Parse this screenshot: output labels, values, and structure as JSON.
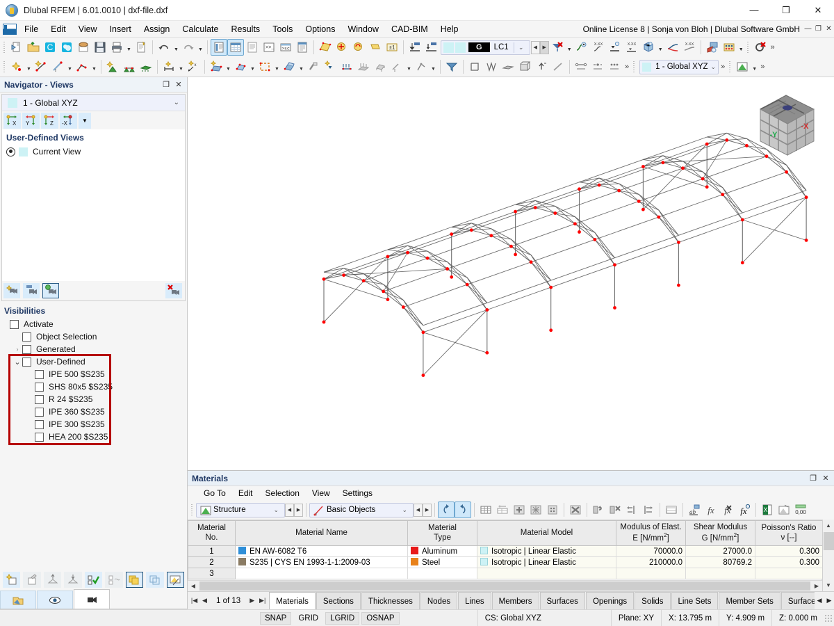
{
  "titlebar": {
    "title": "Dlubal RFEM | 6.01.0010 | dxf-file.dxf",
    "minimize": "—",
    "maximize": "❐",
    "close": "✕"
  },
  "menubar": {
    "items": [
      "File",
      "Edit",
      "View",
      "Insert",
      "Assign",
      "Calculate",
      "Results",
      "Tools",
      "Options",
      "Window",
      "CAD-BIM",
      "Help"
    ],
    "license": "Online License 8 | Sonja von Bloh | Dlubal Software GmbH",
    "mdi_minimize": "—",
    "mdi_restore": "❐",
    "mdi_close": "✕"
  },
  "toolbar": {
    "load_case": {
      "tag": "G",
      "name": "LC1"
    },
    "view_select": "1 - Global XYZ",
    "overflow": "»"
  },
  "navigator": {
    "title": "Navigator - Views",
    "restore_icon": "❐",
    "close_icon": "✕",
    "view_current": "1 - Global XYZ",
    "axis_buttons": [
      "X",
      "Y",
      "Z",
      "-X"
    ],
    "user_defined_views_label": "User-Defined Views",
    "current_view_label": "Current View",
    "visibilities_label": "Visibilities",
    "tree": [
      {
        "label": "Activate",
        "indent": 0,
        "checked": false,
        "expander": ""
      },
      {
        "label": "Object Selection",
        "indent": 1,
        "checked": false,
        "expander": ""
      },
      {
        "label": "Generated",
        "indent": 1,
        "checked": false,
        "expander": "›"
      },
      {
        "label": "User-Defined",
        "indent": 1,
        "checked": false,
        "expander": "⌄"
      },
      {
        "label": "IPE 500 $S235",
        "indent": 2,
        "checked": false,
        "expander": ""
      },
      {
        "label": "SHS 80x5 $S235",
        "indent": 2,
        "checked": false,
        "expander": ""
      },
      {
        "label": "R 24 $S235",
        "indent": 2,
        "checked": false,
        "expander": ""
      },
      {
        "label": "IPE 360 $S235",
        "indent": 2,
        "checked": false,
        "expander": ""
      },
      {
        "label": "IPE 300 $S235",
        "indent": 2,
        "checked": false,
        "expander": ""
      },
      {
        "label": "HEA 200 $S235",
        "indent": 2,
        "checked": false,
        "expander": ""
      }
    ],
    "highlight_color": "#b50000"
  },
  "viewcube": {
    "face_left_label": "-Y",
    "face_right_label": "-X",
    "left_color": "#1faa4b",
    "right_color": "#d32f2f"
  },
  "materials_panel": {
    "title": "Materials",
    "restore_icon": "❐",
    "close_icon": "✕",
    "menu": [
      "Go To",
      "Edit",
      "Selection",
      "View",
      "Settings"
    ],
    "combo_structure": "Structure",
    "combo_objects": "Basic Objects",
    "columns": [
      {
        "line1": "Material",
        "line2": "No."
      },
      {
        "line1": "Material Name",
        "line2": ""
      },
      {
        "line1": "Material",
        "line2": "Type"
      },
      {
        "line1": "Material Model",
        "line2": ""
      },
      {
        "line1": "Modulus of Elast.",
        "line2": "E [N/mm2]"
      },
      {
        "line1": "Shear Modulus",
        "line2": "G [N/mm2]"
      },
      {
        "line1": "Poisson's Ratio",
        "line2": "ν [--]"
      }
    ],
    "rows": [
      {
        "no": "1",
        "name": "EN AW-6082 T6",
        "name_color": "#2f8fd8",
        "type": "Aluminum",
        "type_color": "#e81a1a",
        "model": "Isotropic | Linear Elastic",
        "model_color": "#cdf2f5",
        "e": "70000.0",
        "g": "27000.0",
        "nu": "0.300"
      },
      {
        "no": "2",
        "name": "S235 | CYS EN 1993-1-1:2009-03",
        "name_color": "#8a7b63",
        "type": "Steel",
        "type_color": "#e8811a",
        "model": "Isotropic | Linear Elastic",
        "model_color": "#cdf2f5",
        "e": "210000.0",
        "g": "80769.2",
        "nu": "0.300"
      },
      {
        "no": "3",
        "name": "",
        "name_color": "",
        "type": "",
        "type_color": "",
        "model": "",
        "model_color": "",
        "e": "",
        "g": "",
        "nu": ""
      }
    ],
    "pager": "1 of 13",
    "tabs": [
      "Materials",
      "Sections",
      "Thicknesses",
      "Nodes",
      "Lines",
      "Members",
      "Surfaces",
      "Openings",
      "Solids",
      "Line Sets",
      "Member Sets",
      "Surface S"
    ],
    "active_tab": "Materials"
  },
  "statusbar": {
    "toggles": [
      {
        "label": "SNAP",
        "on": true
      },
      {
        "label": "GRID",
        "on": false
      },
      {
        "label": "LGRID",
        "on": true
      },
      {
        "label": "OSNAP",
        "on": true
      }
    ],
    "cs": "CS: Global XYZ",
    "plane": "Plane: XY",
    "x": "X: 13.795 m",
    "y": "Y: 4.909 m",
    "z": "Z: 0.000 m"
  },
  "model": {
    "node_color": "#ff0000",
    "line_color": "#555555",
    "background": "#ffffff"
  }
}
